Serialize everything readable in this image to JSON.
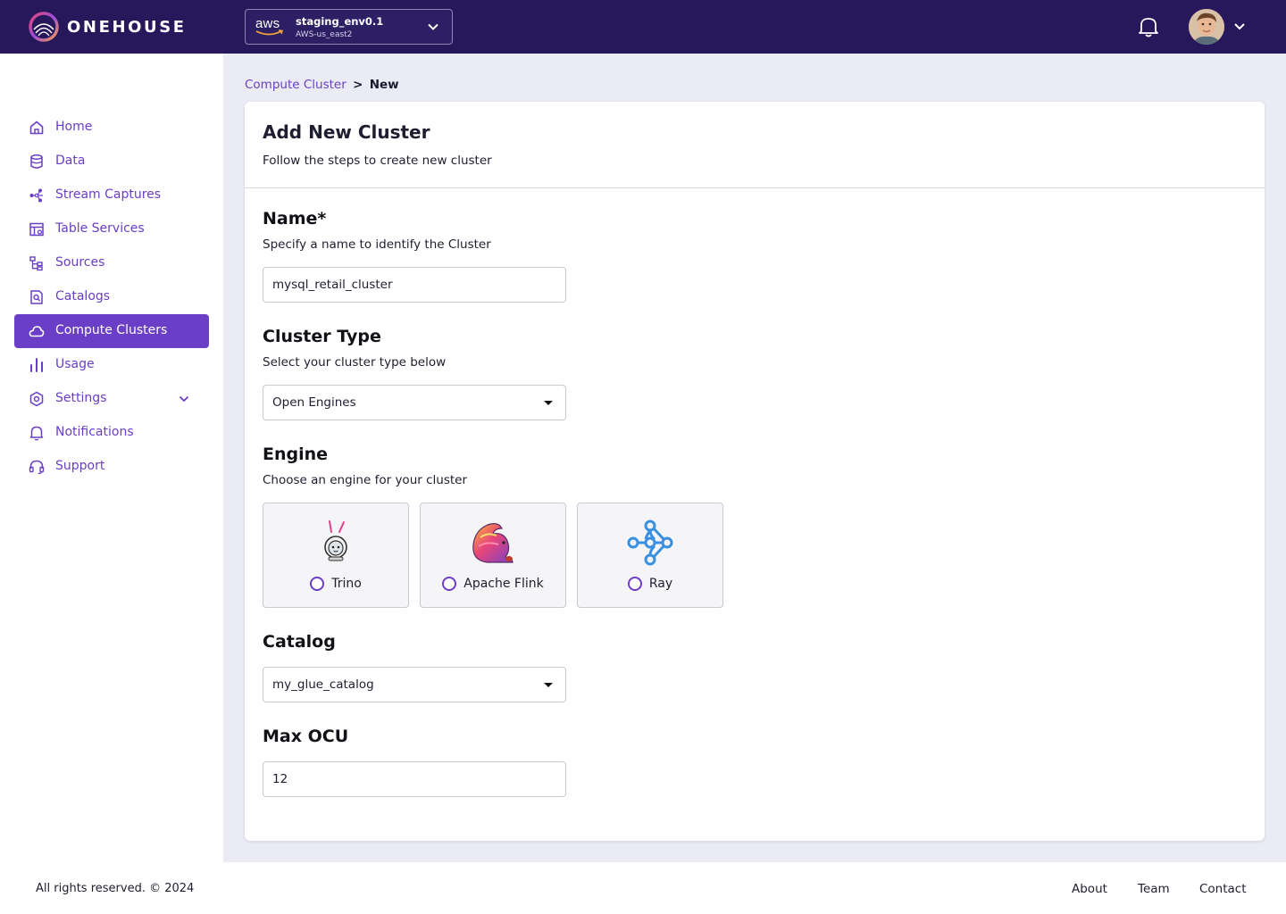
{
  "brand": {
    "name": "ONEHOUSE"
  },
  "environment": {
    "provider": "aws",
    "name": "staging_env0.1",
    "region": "AWS-us_east2"
  },
  "sidebar": {
    "items": [
      {
        "label": "Home",
        "icon": "home-icon"
      },
      {
        "label": "Data",
        "icon": "database-icon"
      },
      {
        "label": "Stream Captures",
        "icon": "share-nodes-icon"
      },
      {
        "label": "Table Services",
        "icon": "table-services-icon"
      },
      {
        "label": "Sources",
        "icon": "tree-icon"
      },
      {
        "label": "Catalogs",
        "icon": "catalog-search-icon"
      },
      {
        "label": "Compute Clusters",
        "icon": "cloud-icon",
        "active": true
      },
      {
        "label": "Usage",
        "icon": "bar-chart-icon"
      },
      {
        "label": "Settings",
        "icon": "gear-icon",
        "expandable": true
      },
      {
        "label": "Notifications",
        "icon": "bell-icon"
      },
      {
        "label": "Support",
        "icon": "headset-icon"
      }
    ]
  },
  "breadcrumb": {
    "parent": "Compute Cluster",
    "separator": ">",
    "current": "New"
  },
  "form": {
    "title": "Add New Cluster",
    "subtitle": "Follow the steps to create new cluster",
    "name": {
      "label": "Name*",
      "description": "Specify a name to identify the Cluster",
      "value": "mysql_retail_cluster"
    },
    "cluster_type": {
      "label": "Cluster Type",
      "description": "Select your cluster type below",
      "value": "Open Engines"
    },
    "engine": {
      "label": "Engine",
      "description": "Choose an engine for your cluster",
      "options": [
        {
          "label": "Trino",
          "icon": "trino-bunny-icon",
          "selected": false
        },
        {
          "label": "Apache Flink",
          "icon": "flink-squirrel-icon",
          "selected": false
        },
        {
          "label": "Ray",
          "icon": "ray-network-icon",
          "selected": false
        }
      ]
    },
    "catalog": {
      "label": "Catalog",
      "value": "my_glue_catalog"
    },
    "max_ocu": {
      "label": "Max OCU",
      "value": "12"
    }
  },
  "footer": {
    "copyright": "All rights reserved. © 2024",
    "links": [
      "About",
      "Team",
      "Contact"
    ]
  },
  "colors": {
    "topbar": "#26185a",
    "accent": "#6a3ec6",
    "main_bg": "#ebebf5",
    "ray_blue": "#3b8fe0"
  }
}
